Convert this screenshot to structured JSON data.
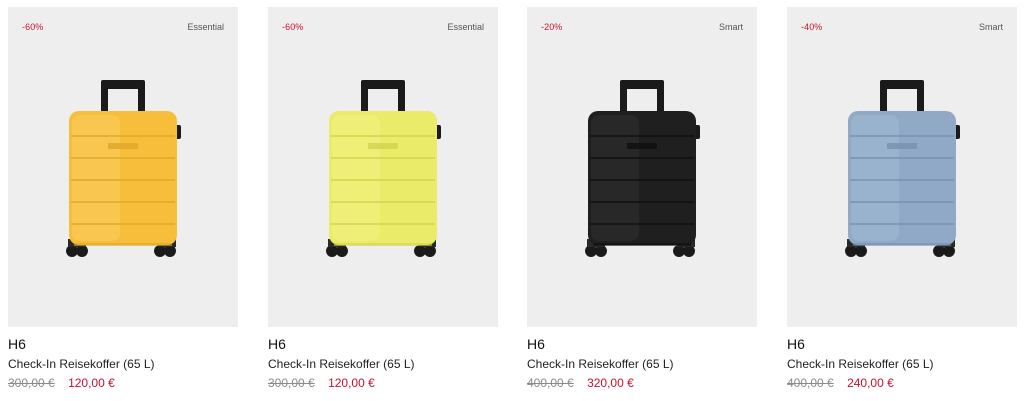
{
  "products": [
    {
      "discount": "-60%",
      "tag": "Essential",
      "model": "H6",
      "description": "Check-In Reisekoffer (65 L)",
      "old_price": "300,00 €",
      "new_price": "120,00 €",
      "color_name": "yellow",
      "body_color": "#F7BE3C",
      "body_light": "#FBD066",
      "body_dark": "#E0A52A"
    },
    {
      "discount": "-60%",
      "tag": "Essential",
      "model": "H6",
      "description": "Check-In Reisekoffer (65 L)",
      "old_price": "300,00 €",
      "new_price": "120,00 €",
      "color_name": "lime",
      "body_color": "#EBEB6A",
      "body_light": "#F4F48A",
      "body_dark": "#D2D24C"
    },
    {
      "discount": "-20%",
      "tag": "Smart",
      "model": "H6",
      "description": "Check-In Reisekoffer (65 L)",
      "old_price": "400,00 €",
      "new_price": "320,00 €",
      "color_name": "black",
      "body_color": "#1F1F1F",
      "body_light": "#333333",
      "body_dark": "#0E0E0E"
    },
    {
      "discount": "-40%",
      "tag": "Smart",
      "model": "H6",
      "description": "Check-In Reisekoffer (65 L)",
      "old_price": "400,00 €",
      "new_price": "240,00 €",
      "color_name": "light blue",
      "body_color": "#8FA9C6",
      "body_light": "#A6BDD6",
      "body_dark": "#7690AE"
    }
  ]
}
